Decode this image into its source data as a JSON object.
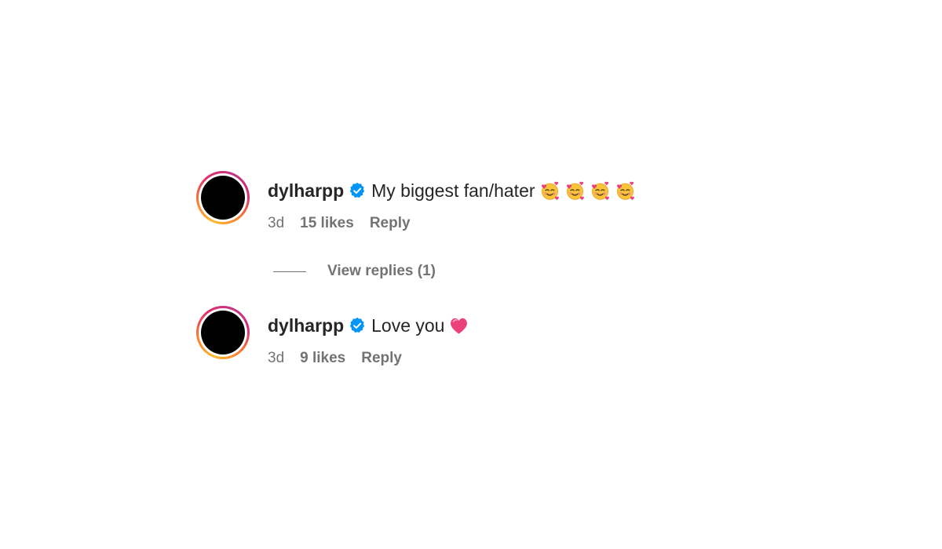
{
  "comments": [
    {
      "username": "dylharpp",
      "verified": true,
      "text": "My biggest fan/hater",
      "emojis": [
        "smiling-face-with-hearts",
        "smiling-face-with-hearts",
        "smiling-face-with-hearts",
        "smiling-face-with-hearts"
      ],
      "time": "3d",
      "likes": "15 likes",
      "reply_label": "Reply"
    },
    {
      "username": "dylharpp",
      "verified": true,
      "text": "Love you",
      "emojis": [
        "pink-heart"
      ],
      "time": "3d",
      "likes": "9 likes",
      "reply_label": "Reply"
    }
  ],
  "view_replies": {
    "label": "View replies (1)"
  },
  "colors": {
    "text_primary": "#262626",
    "text_secondary": "#737373",
    "verified_blue": "#0095f6",
    "heart_pink": "#ec407a",
    "avatar_fill": "#000000"
  }
}
